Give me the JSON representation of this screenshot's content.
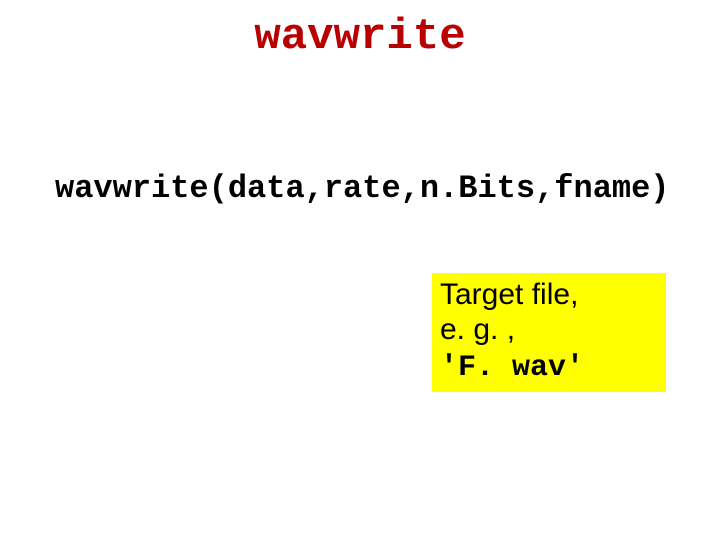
{
  "title": "wavwrite",
  "signature": "wavwrite(data,rate,n.Bits,fname)",
  "callout": {
    "line1": "Target file,",
    "line2": "e. g. ,",
    "line3": "'F. wav'"
  }
}
